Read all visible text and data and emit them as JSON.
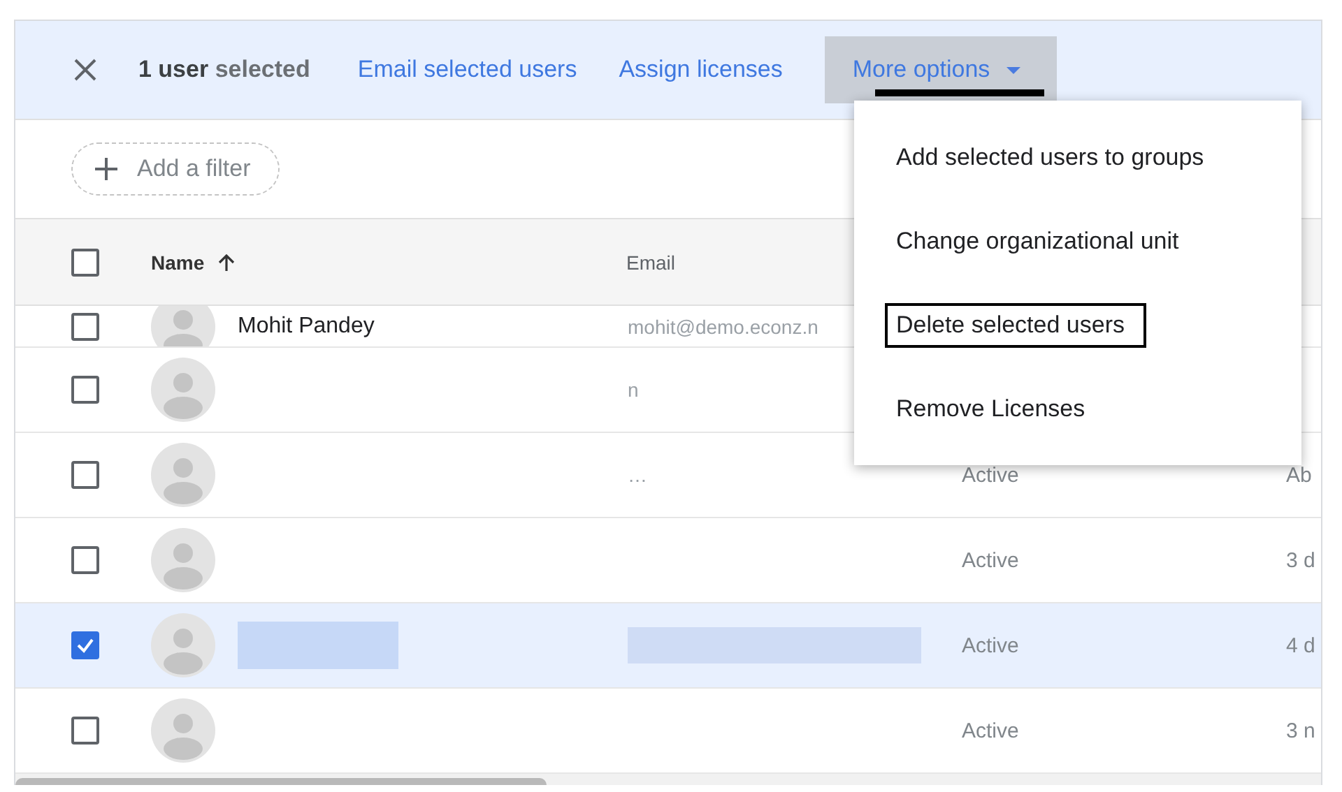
{
  "action_bar": {
    "selection_label": "**1 user** selected",
    "actions": [
      {
        "label": "Email selected users"
      },
      {
        "label": "Assign licenses"
      }
    ],
    "more_options": {
      "label": "More options",
      "expanded": true
    }
  },
  "filter": {
    "label": "Add a filter"
  },
  "table": {
    "header": {
      "checked": false,
      "columns": [
        {
          "label": "Name",
          "sorted_ascending": true
        },
        {
          "label": "Email"
        }
      ]
    },
    "rows": [
      {
        "name": "Mohit Pandey",
        "email": "mohit@demo.econz.n",
        "selected": false,
        "redacted": false
      },
      {
        "email": "n",
        "selected": false,
        "redacted": false
      },
      {
        "email": "…",
        "column_4": "Active",
        "column_5": "Ab",
        "selected": false,
        "redacted": false
      },
      {
        "column_4": "Active",
        "column_5": "3 d",
        "selected": false,
        "redacted": false
      },
      {
        "column_4": "Active",
        "column_5": "4 d",
        "selected": true,
        "redacted": true
      },
      {
        "column_4": "Active",
        "column_5": "3 n",
        "selected": false,
        "redacted": false
      }
    ]
  },
  "menu": {
    "items": [
      {
        "label": "Add selected users to groups",
        "outlined": false
      },
      {
        "label": "Change organizational unit",
        "outlined": false
      },
      {
        "label": "Delete selected users",
        "outlined": true
      },
      {
        "label": "Remove Licenses",
        "outlined": false
      }
    ]
  }
}
